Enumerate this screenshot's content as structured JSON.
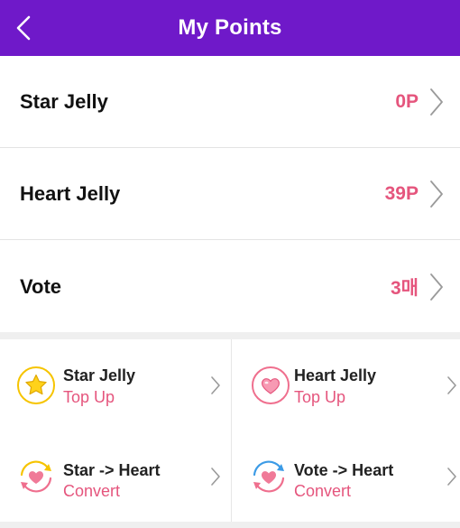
{
  "header": {
    "title": "My Points",
    "background": "#6f19c9",
    "back_icon": "chevron-left-icon"
  },
  "points": [
    {
      "label": "Star Jelly",
      "value": "0P"
    },
    {
      "label": "Heart Jelly",
      "value": "39P"
    },
    {
      "label": "Vote",
      "value": "3매"
    }
  ],
  "actions": [
    {
      "title": "Star Jelly",
      "subtitle": "Top Up",
      "icon": "star-jelly-icon"
    },
    {
      "title": "Heart Jelly",
      "subtitle": "Top Up",
      "icon": "heart-jelly-icon"
    },
    {
      "title": "Star -> Heart",
      "subtitle": "Convert",
      "icon": "star-to-heart-convert-icon"
    },
    {
      "title": "Vote -> Heart",
      "subtitle": "Convert",
      "icon": "vote-to-heart-convert-icon"
    }
  ],
  "colors": {
    "accent": "#e5557d",
    "star": "#f6c400",
    "heart": "#ef6f8e",
    "vote": "#3c9be6"
  }
}
